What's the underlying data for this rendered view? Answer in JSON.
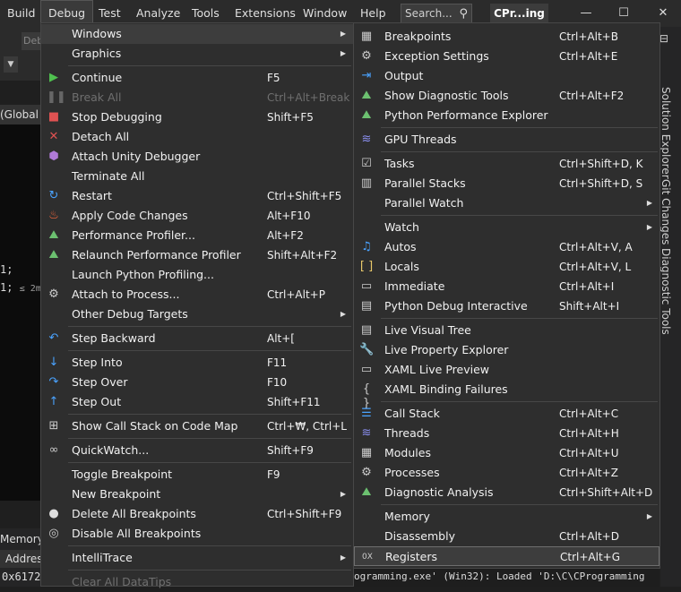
{
  "menubar": {
    "items": [
      "Build",
      "Debug",
      "Test",
      "Analyze",
      "Tools",
      "Extensions",
      "Window",
      "Help"
    ],
    "search_placeholder": "Search...",
    "title": "CPr...ing",
    "window_buttons": [
      "—",
      "☐",
      "✕"
    ]
  },
  "background": {
    "toolbar_combo": "Deb",
    "global_scope": "(Global Sc",
    "code_lines": [
      "1;",
      "1;"
    ],
    "code_hint": "≤ 2m",
    "memory_tab": "Memory",
    "address_label": "Address",
    "address_value": "0x6172",
    "output_text": "ogramming.exe' (Win32): Loaded 'D:\\C\\CProgramming",
    "right_tabs": [
      "Solution Explorer",
      "Git Changes",
      "Diagnostic Tools"
    ]
  },
  "debug_menu": {
    "items": [
      {
        "label": "Windows",
        "shortcut": "",
        "submenu": true,
        "icon": "none",
        "highlighted": true
      },
      {
        "label": "Graphics",
        "shortcut": "",
        "submenu": true,
        "icon": "none"
      },
      {
        "label": "Continue",
        "shortcut": "F5",
        "icon": "play-icon"
      },
      {
        "label": "Break All",
        "shortcut": "Ctrl+Alt+Break",
        "icon": "pause-icon",
        "disabled": true
      },
      {
        "label": "Stop Debugging",
        "shortcut": "Shift+F5",
        "icon": "stop-icon"
      },
      {
        "label": "Detach All",
        "shortcut": "",
        "icon": "detach-icon"
      },
      {
        "label": "Attach Unity Debugger",
        "shortcut": "",
        "icon": "unity-icon"
      },
      {
        "label": "Terminate All",
        "shortcut": "",
        "icon": "none"
      },
      {
        "label": "Restart",
        "shortcut": "Ctrl+Shift+F5",
        "icon": "restart-icon"
      },
      {
        "label": "Apply Code Changes",
        "shortcut": "Alt+F10",
        "icon": "hot-reload-icon"
      },
      {
        "label": "Performance Profiler...",
        "shortcut": "Alt+F2",
        "icon": "profiler-icon"
      },
      {
        "label": "Relaunch Performance Profiler",
        "shortcut": "Shift+Alt+F2",
        "icon": "profiler-icon"
      },
      {
        "label": "Launch Python Profiling...",
        "shortcut": "",
        "icon": "none"
      },
      {
        "label": "Attach to Process...",
        "shortcut": "Ctrl+Alt+P",
        "icon": "attach-process-icon"
      },
      {
        "label": "Other Debug Targets",
        "shortcut": "",
        "submenu": true,
        "icon": "none"
      },
      {
        "label": "Step Backward",
        "shortcut": "Alt+[",
        "icon": "step-backward-icon"
      },
      {
        "label": "Step Into",
        "shortcut": "F11",
        "icon": "step-into-icon"
      },
      {
        "label": "Step Over",
        "shortcut": "F10",
        "icon": "step-over-icon"
      },
      {
        "label": "Step Out",
        "shortcut": "Shift+F11",
        "icon": "step-out-icon"
      },
      {
        "label": "Show Call Stack on Code Map",
        "shortcut": "Ctrl+₩, Ctrl+L",
        "icon": "code-map-icon"
      },
      {
        "label": "QuickWatch...",
        "shortcut": "Shift+F9",
        "icon": "quickwatch-icon"
      },
      {
        "label": "Toggle Breakpoint",
        "shortcut": "F9",
        "icon": "none"
      },
      {
        "label": "New Breakpoint",
        "shortcut": "",
        "submenu": true,
        "icon": "none"
      },
      {
        "label": "Delete All Breakpoints",
        "shortcut": "Ctrl+Shift+F9",
        "icon": "delete-breakpoints-icon"
      },
      {
        "label": "Disable All Breakpoints",
        "shortcut": "",
        "icon": "disable-breakpoints-icon"
      },
      {
        "label": "IntelliTrace",
        "shortcut": "",
        "submenu": true,
        "icon": "none"
      },
      {
        "label": "Clear All DataTips",
        "shortcut": "",
        "icon": "none",
        "disabled": true
      }
    ]
  },
  "windows_menu": {
    "items": [
      {
        "label": "Breakpoints",
        "shortcut": "Ctrl+Alt+B",
        "icon": "breakpoints-window-icon"
      },
      {
        "label": "Exception Settings",
        "shortcut": "Ctrl+Alt+E",
        "icon": "exception-settings-icon"
      },
      {
        "label": "Output",
        "shortcut": "",
        "icon": "output-icon"
      },
      {
        "label": "Show Diagnostic Tools",
        "shortcut": "Ctrl+Alt+F2",
        "icon": "diagnostic-tools-icon"
      },
      {
        "label": "Python Performance Explorer",
        "shortcut": "",
        "icon": "performance-explorer-icon"
      },
      {
        "label": "GPU Threads",
        "shortcut": "",
        "icon": "gpu-threads-icon"
      },
      {
        "label": "Tasks",
        "shortcut": "Ctrl+Shift+D, K",
        "icon": "tasks-icon"
      },
      {
        "label": "Parallel Stacks",
        "shortcut": "Ctrl+Shift+D, S",
        "icon": "parallel-stacks-icon"
      },
      {
        "label": "Parallel Watch",
        "shortcut": "",
        "submenu": true,
        "icon": "none"
      },
      {
        "label": "Watch",
        "shortcut": "",
        "submenu": true,
        "icon": "none"
      },
      {
        "label": "Autos",
        "shortcut": "Ctrl+Alt+V, A",
        "icon": "autos-icon"
      },
      {
        "label": "Locals",
        "shortcut": "Ctrl+Alt+V, L",
        "icon": "locals-icon"
      },
      {
        "label": "Immediate",
        "shortcut": "Ctrl+Alt+I",
        "icon": "immediate-icon"
      },
      {
        "label": "Python Debug Interactive",
        "shortcut": "Shift+Alt+I",
        "icon": "python-interactive-icon"
      },
      {
        "label": "Live Visual Tree",
        "shortcut": "",
        "icon": "live-visual-tree-icon"
      },
      {
        "label": "Live Property Explorer",
        "shortcut": "",
        "icon": "live-property-explorer-icon"
      },
      {
        "label": "XAML Live Preview",
        "shortcut": "",
        "icon": "xaml-live-preview-icon"
      },
      {
        "label": "XAML Binding Failures",
        "shortcut": "",
        "icon": "xaml-binding-failures-icon"
      },
      {
        "label": "Call Stack",
        "shortcut": "Ctrl+Alt+C",
        "icon": "call-stack-icon"
      },
      {
        "label": "Threads",
        "shortcut": "Ctrl+Alt+H",
        "icon": "threads-icon"
      },
      {
        "label": "Modules",
        "shortcut": "Ctrl+Alt+U",
        "icon": "modules-icon"
      },
      {
        "label": "Processes",
        "shortcut": "Ctrl+Alt+Z",
        "icon": "processes-icon"
      },
      {
        "label": "Diagnostic Analysis",
        "shortcut": "Ctrl+Shift+Alt+D",
        "icon": "diagnostic-analysis-icon"
      },
      {
        "label": "Memory",
        "shortcut": "",
        "submenu": true,
        "icon": "none"
      },
      {
        "label": "Disassembly",
        "shortcut": "Ctrl+Alt+D",
        "icon": "none"
      },
      {
        "label": "Registers",
        "shortcut": "Ctrl+Alt+G",
        "icon": "registers-icon",
        "selected": true
      }
    ]
  }
}
